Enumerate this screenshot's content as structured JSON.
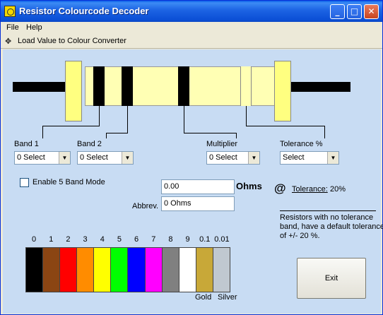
{
  "window": {
    "title": "Resistor Colourcode Decoder",
    "minimize_glyph": "_",
    "maximize_glyph": "□",
    "close_glyph": "✕"
  },
  "menu": {
    "file": "File",
    "help": "Help"
  },
  "toolbar": {
    "icon": "✥",
    "load_label": "Load Value to Colour Converter"
  },
  "bands": {
    "band1_label": "Band 1",
    "band1_value": "0 Select",
    "band2_label": "Band 2",
    "band2_value": "0 Select",
    "multiplier_label": "Multiplier",
    "multiplier_value": "0 Select",
    "tolerance_label": "Tolerance %",
    "tolerance_value": "Select"
  },
  "options": {
    "five_band_label": "Enable 5 Band Mode",
    "five_band_checked": false
  },
  "result": {
    "value": "0.00",
    "unit": "Ohms",
    "abbrev_label": "Abbrev.",
    "abbrev_value": "0 Ohms",
    "at_symbol": "@",
    "tolerance_label": "Tolerance:",
    "tolerance_value": "20%"
  },
  "note": "Resistors with no tolerance band, have a default tolerance of +/- 20 %.",
  "palette": {
    "top_labels": [
      "0",
      "1",
      "2",
      "3",
      "4",
      "5",
      "6",
      "7",
      "8",
      "9",
      "0.1",
      "0.01"
    ],
    "colors": [
      "#000000",
      "#8b4513",
      "#ff0000",
      "#ff8c00",
      "#ffff00",
      "#00ff00",
      "#0000ff",
      "#ff00ff",
      "#808080",
      "#ffffff",
      "#c8a838",
      "#c0c8d0"
    ],
    "gold_label": "Gold",
    "silver_label": "Silver"
  },
  "exit_label": "Exit",
  "colors": {
    "body": "#ffffb4",
    "cap": "#ffff80",
    "client_bg": "#c8dcf3"
  }
}
